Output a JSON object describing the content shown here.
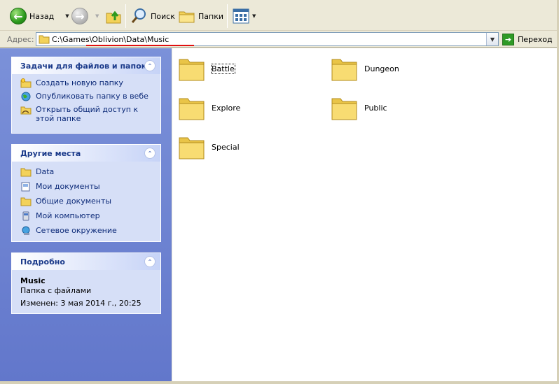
{
  "toolbar": {
    "back_label": "Назад",
    "search_label": "Поиск",
    "folders_label": "Папки"
  },
  "address": {
    "label": "Адрес:",
    "path": "C:\\Games\\Oblivion\\Data\\Music",
    "go_label": "Переход"
  },
  "tasks_panel": {
    "title": "Задачи для файлов и папок",
    "items": [
      {
        "label": "Создать новую папку",
        "icon": "new-folder-icon"
      },
      {
        "label": "Опубликовать папку в вебе",
        "icon": "web-publish-icon"
      },
      {
        "label": "Открыть общий доступ к этой папке",
        "icon": "share-folder-icon"
      }
    ]
  },
  "places_panel": {
    "title": "Другие места",
    "items": [
      {
        "label": "Data",
        "icon": "folder-icon"
      },
      {
        "label": "Мои документы",
        "icon": "my-documents-icon"
      },
      {
        "label": "Общие документы",
        "icon": "folder-icon"
      },
      {
        "label": "Мой компьютер",
        "icon": "my-computer-icon"
      },
      {
        "label": "Сетевое окружение",
        "icon": "network-icon"
      }
    ]
  },
  "details_panel": {
    "title": "Подробно",
    "name": "Music",
    "type": "Папка с файлами",
    "modified": "Изменен: 3 мая 2014 г., 20:25"
  },
  "folders": [
    {
      "name": "Battle"
    },
    {
      "name": "Dungeon"
    },
    {
      "name": "Explore"
    },
    {
      "name": "Public"
    },
    {
      "name": "Special"
    }
  ],
  "colors": {
    "panel_title": "#1b3a8a",
    "link_text": "#0c2a78",
    "folder_yellow": "#f3d25a"
  }
}
